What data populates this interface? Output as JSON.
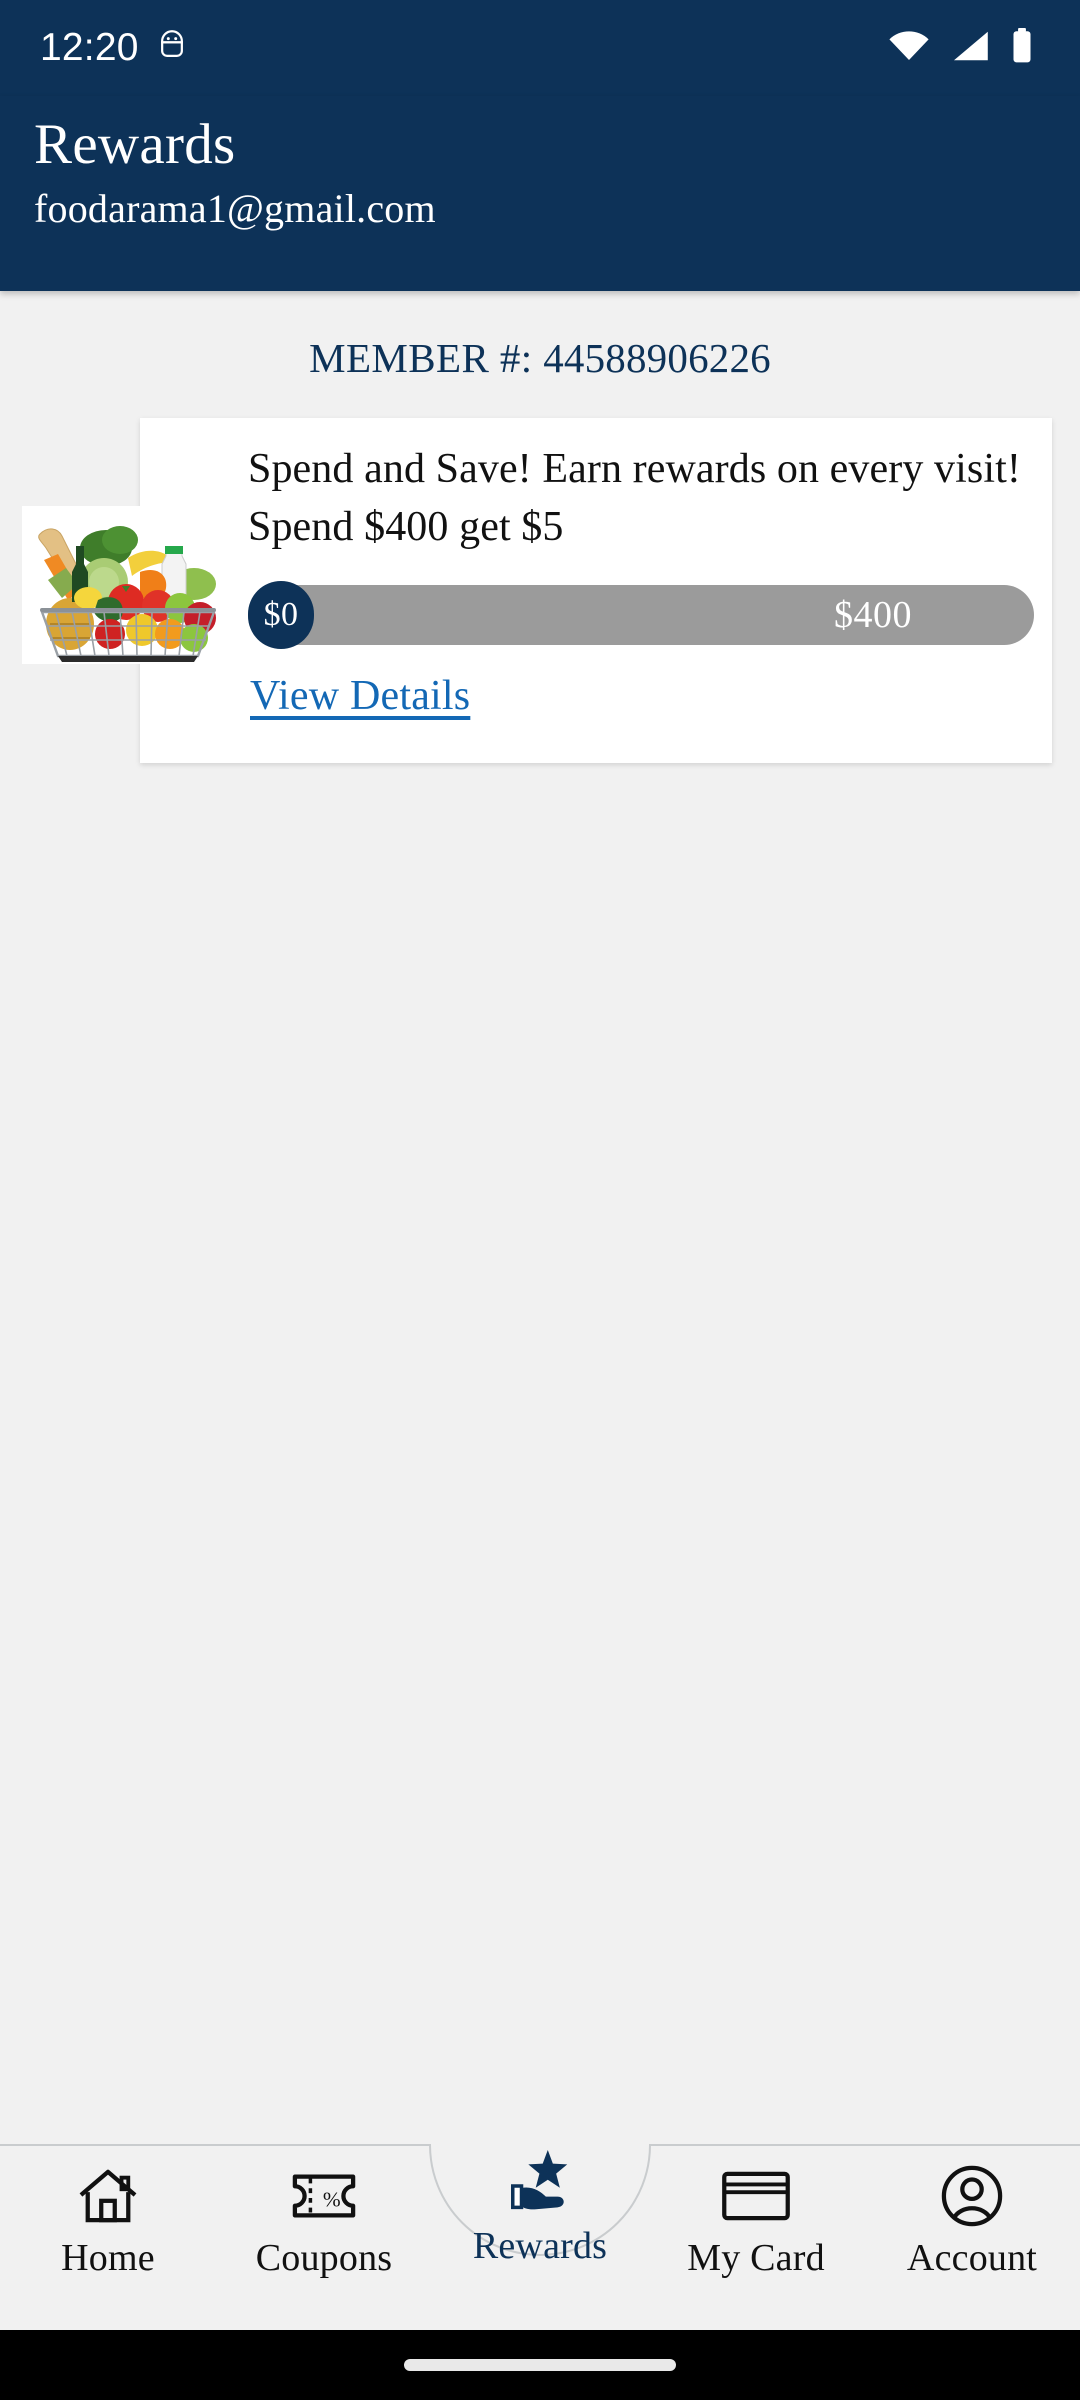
{
  "status_bar": {
    "time": "12:20",
    "icons": [
      "android-head-icon",
      "wifi-icon",
      "cellular-signal-icon",
      "battery-icon"
    ]
  },
  "header": {
    "title": "Rewards",
    "email": "foodarama1@gmail.com",
    "background_color": "#0d3258"
  },
  "main": {
    "member_label": "MEMBER #:",
    "member_number": "44588906226",
    "reward_card": {
      "image": "grocery-basket-photo",
      "headline": "Spend and Save! Earn rewards on every visit! Spend $400 get $5",
      "progress": {
        "current_value": "$0",
        "goal_value": "$400",
        "percent": 0,
        "track_color": "#9b9b9b",
        "knob_color": "#0d3258"
      },
      "view_details_label": "View Details",
      "link_color": "#1368b5"
    }
  },
  "bottom_nav": {
    "active_color": "#0d3258",
    "inactive_color": "#111111",
    "items": [
      {
        "label": "Home",
        "icon": "home-icon",
        "active": false
      },
      {
        "label": "Coupons",
        "icon": "coupon-icon",
        "active": false
      },
      {
        "label": "Rewards",
        "icon": "hand-star-icon",
        "active": true
      },
      {
        "label": "My Card",
        "icon": "card-icon",
        "active": false
      },
      {
        "label": "Account",
        "icon": "account-icon",
        "active": false
      }
    ]
  }
}
